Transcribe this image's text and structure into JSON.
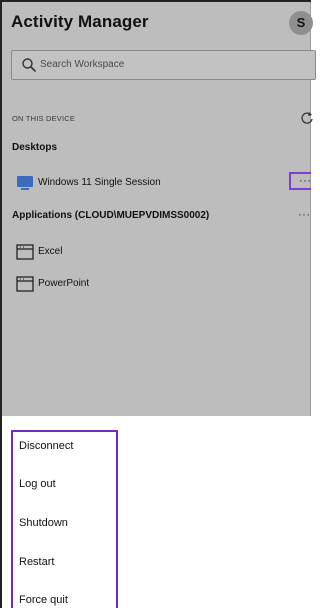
{
  "header": {
    "title": "Activity Manager",
    "avatar_initial": "S"
  },
  "search": {
    "placeholder": "Search Workspace"
  },
  "device_section": {
    "label": "ON THIS DEVICE",
    "desktops_label": "Desktops",
    "desktops": [
      {
        "label": "Windows 11 Single Session",
        "icon": "monitor-icon"
      }
    ],
    "applications_label": "Applications (CLOUD\\MUEPVDIMSS0002)",
    "applications": [
      {
        "label": "Excel",
        "icon": "app-window-icon"
      },
      {
        "label": "PowerPoint",
        "icon": "app-window-icon"
      }
    ],
    "more_glyph": "···"
  },
  "context_menu": {
    "items": [
      {
        "label": "Disconnect"
      },
      {
        "label": "Log out"
      },
      {
        "label": "Shutdown"
      },
      {
        "label": "Restart"
      },
      {
        "label": "Force quit"
      }
    ]
  },
  "colors": {
    "overlay_gray": "#bdbdbd",
    "highlight_purple": "#6b2fbf",
    "monitor_blue": "#3b6bbf"
  }
}
